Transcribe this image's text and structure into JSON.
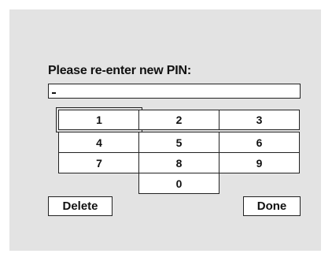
{
  "dialog": {
    "prompt": "Please re-enter new PIN:",
    "pin_value": "-"
  },
  "keypad": {
    "keys": [
      "1",
      "2",
      "3",
      "4",
      "5",
      "6",
      "7",
      "8",
      "9",
      "0"
    ],
    "selected_key": "1"
  },
  "actions": {
    "delete_label": "Delete",
    "done_label": "Done"
  }
}
